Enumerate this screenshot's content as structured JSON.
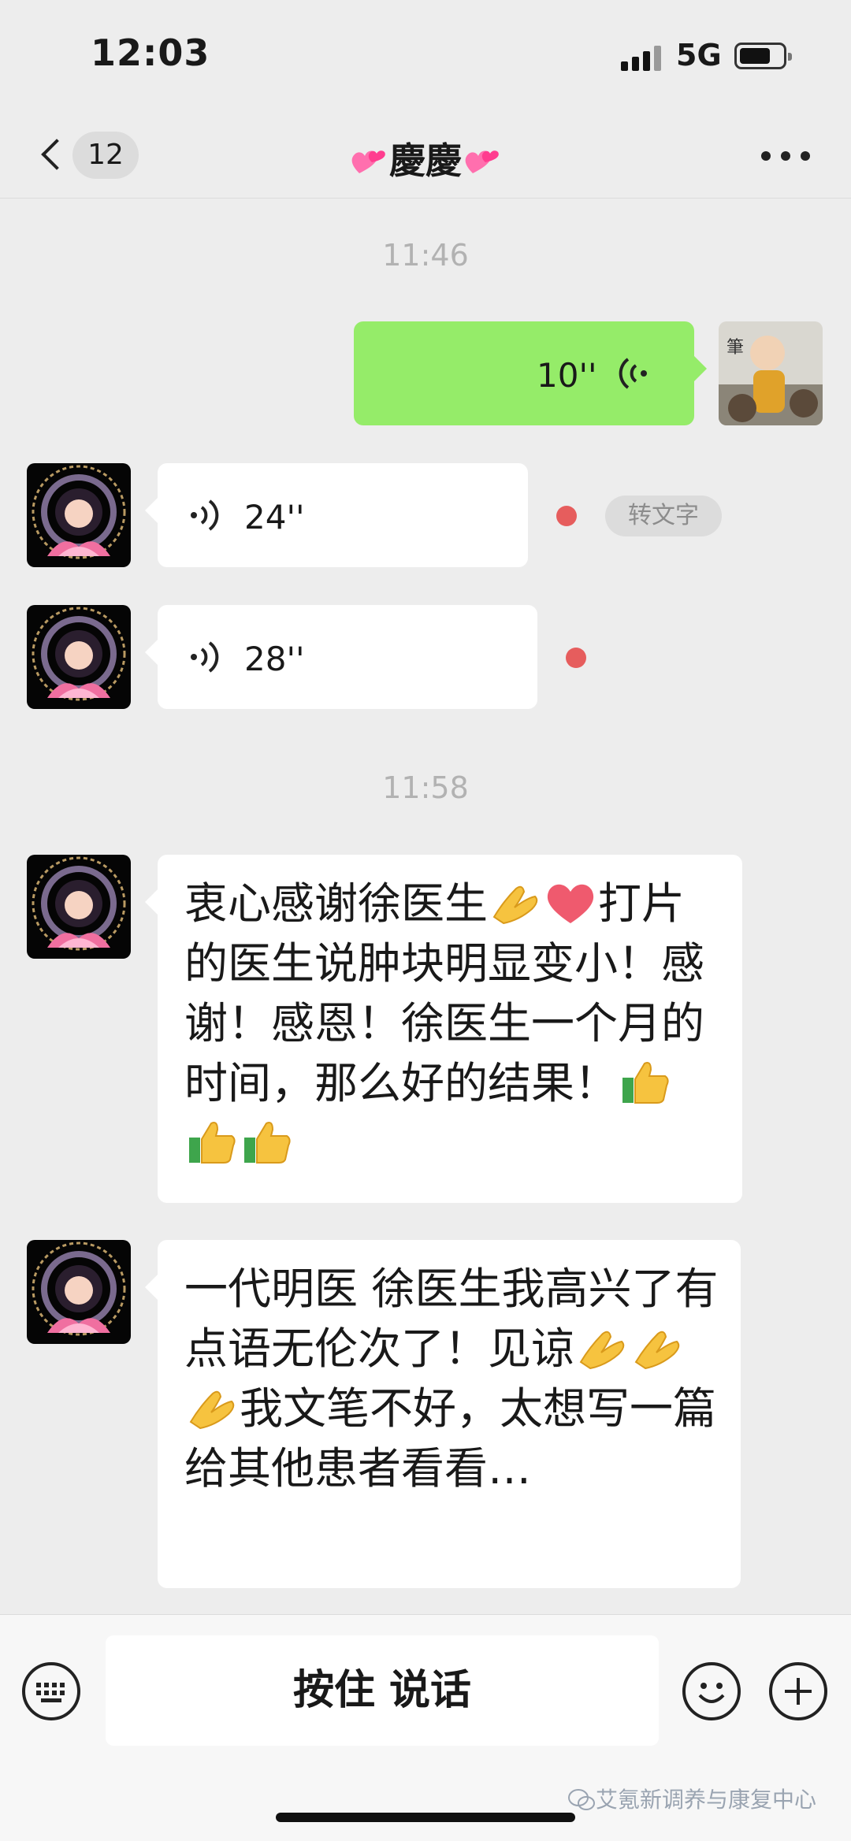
{
  "status_bar": {
    "time": "12:03",
    "network": "5G"
  },
  "nav": {
    "unread_count": "12",
    "title": "慶慶"
  },
  "messages": {
    "time1": "11:46",
    "m1_duration": "10''",
    "m2_duration": "24''",
    "m2_transcribe": "转文字",
    "m3_duration": "28''",
    "time2": "11:58",
    "m4_line1": "衷心感谢徐医生",
    "m4_line2": "打片的医生说肿块明显变小！感谢！感恩！徐医生一个月的时间，那么好的结果！",
    "m5_part1": "一代明医 徐医生我高兴了有点语无伦次了！见谅",
    "m5_part2": "我文笔不好，太想写一篇给其他患者看看…"
  },
  "input_bar": {
    "hold_to_talk": "按住 说话"
  },
  "watermark": {
    "text": "艾氪新调养与康复中心"
  },
  "colors": {
    "sent_bubble": "#95ec69",
    "received_bubble": "#ffffff",
    "background": "#ededed",
    "unread_dot": "#e65d5d"
  }
}
